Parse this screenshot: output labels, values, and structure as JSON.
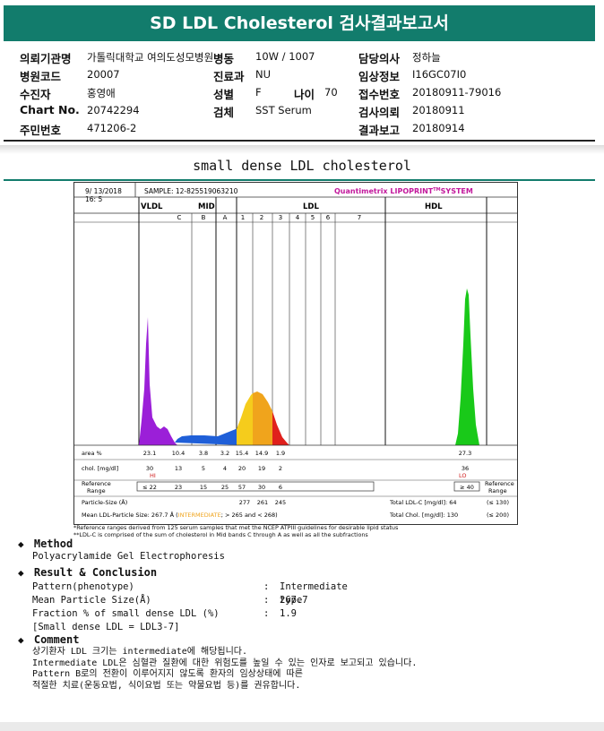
{
  "header": {
    "title": "SD LDL Cholesterol 검사결과보고서"
  },
  "info": {
    "institution_label": "의뢰기관명",
    "institution_value": "가톨릭대학교 여의도성모병원",
    "ward_label": "병동",
    "ward_value": "10W / 1007",
    "doctor_label": "담당의사",
    "doctor_value": "정하늘",
    "hospital_code_label": "병원코드",
    "hospital_code_value": "20007",
    "dept_label": "진료과",
    "dept_value": "NU",
    "clinical_label": "임상정보",
    "clinical_value": "I16GC07I0",
    "patient_label": "수진자",
    "patient_value": "홍영애",
    "sex_label": "성별",
    "sex_value": "F",
    "age_label": "나이",
    "age_value": "70",
    "receipt_label": "접수번호",
    "receipt_value": "20180911-79016",
    "chart_label": "Chart No.",
    "chart_value": "20742294",
    "specimen_label": "검체",
    "specimen_value": "SST Serum",
    "request_label": "검사의뢰",
    "request_value": "20180911",
    "id_label": "주민번호",
    "id_value": "471206-2",
    "report_label": "결과보고",
    "report_value": "20180914"
  },
  "section_title": "small dense LDL cholesterol",
  "chart": {
    "date": "9/ 13/2018",
    "time": "16: 5",
    "sample": "SAMPLE:  12-825519063210",
    "brand": "Quantimetrix LIPOPRINT",
    "brand_tm": "TM",
    "brand_suffix": "SYSTEM",
    "group_vldl": "VLDL",
    "group_mid": "MID",
    "group_ldl": "LDL",
    "group_hdl": "HDL",
    "band_labels": [
      "C",
      "B",
      "A",
      "1",
      "2",
      "3",
      "4",
      "5",
      "6",
      "7"
    ],
    "row_area_label": "area %",
    "area_values": [
      "23.1",
      "10.4",
      "3.8",
      "3.2",
      "15.4",
      "14.9",
      "1.9",
      "27.3"
    ],
    "row_chol_label": "chol. [mg/dl]",
    "chol_values": [
      "30",
      "13",
      "5",
      "4",
      "20",
      "19",
      "2",
      "36"
    ],
    "flag_hi": "HI",
    "flag_lo": "LO",
    "ref_label_1": "Reference",
    "ref_label_2": "Range",
    "ref_values": [
      "≤ 22",
      "23",
      "15",
      "25",
      "57",
      "30",
      "6",
      "≥ 40"
    ],
    "ref_right_1": "Reference",
    "ref_right_2": "Range",
    "particle_label": "Particle-Size (Å)",
    "particle_values": [
      "277",
      "261",
      "245"
    ],
    "total_ldl": "Total LDL-C [mg/dl]:  64",
    "total_ldl_range": "(≤ 130)",
    "mean_particle_a": "Mean LDL-Particle Size:   267.7 Å  (",
    "mean_particle_b": "INTERMEDIATE",
    "mean_particle_c": "; > 265 and < 268)",
    "total_chol": "Total Chol. [mg/dl]:     130",
    "total_chol_range": "(≤ 200)",
    "footnote_1": "*Reference ranges derived from 125 serum samples that met the NCEP ATPIII guidelines for desirable lipid status",
    "footnote_2": "**LDL-C is comprised of the sum of cholesterol in Mid bands C through A as well as all the subfractions"
  },
  "chart_data": {
    "type": "area",
    "title": "small dense LDL cholesterol",
    "xlabel": "",
    "ylabel": "",
    "categories": [
      "VLDL",
      "C",
      "B",
      "A",
      "1",
      "2",
      "3",
      "4",
      "5",
      "6",
      "7",
      "HDL"
    ],
    "series": [
      {
        "name": "area %",
        "values": [
          23.1,
          10.4,
          3.8,
          3.2,
          15.4,
          14.9,
          1.9,
          null,
          null,
          null,
          null,
          27.3
        ]
      },
      {
        "name": "chol. [mg/dl]",
        "values": [
          30,
          13,
          5,
          4,
          20,
          19,
          2,
          null,
          null,
          null,
          null,
          36
        ]
      }
    ],
    "colors": {
      "vldl": "#9b1fd8",
      "mid": "#1f5fd8",
      "ldl1": "#f5cc1c",
      "ldl2": "#f0a41c",
      "ldl3": "#e0201c",
      "hdl": "#19c919"
    },
    "grid": false
  },
  "method": {
    "heading": "Method",
    "text": "Polyacrylamide Gel Electrophoresis"
  },
  "result": {
    "heading": "Result & Conclusion",
    "rows": [
      {
        "label": "Pattern(phenotype)",
        "sep": ":",
        "value": "Intermediate type"
      },
      {
        "label": "Mean Particle Size(Å)",
        "sep": ":",
        "value": "267.7"
      },
      {
        "label": "Fraction % of small dense LDL (%)",
        "sep": ":",
        "value": "1.9"
      }
    ],
    "note": "[Small dense LDL = LDL3-7]"
  },
  "comment": {
    "heading": "Comment",
    "lines": [
      "상기환자 LDL 크기는 intermediate에 해당됩니다.",
      "Intermediate LDL은 심혈관 질환에 대한 위험도를 높일 수 있는 인자로 보고되고 있습니다.",
      "Pattern B로의 전환이 이루어지지 않도록 환자의 임상상태에 따른",
      "적절한 치료(운동요법, 식이요법 또는 약물요법 등)를 권유합니다."
    ]
  },
  "icons": {
    "bullet": "diamond-icon"
  }
}
